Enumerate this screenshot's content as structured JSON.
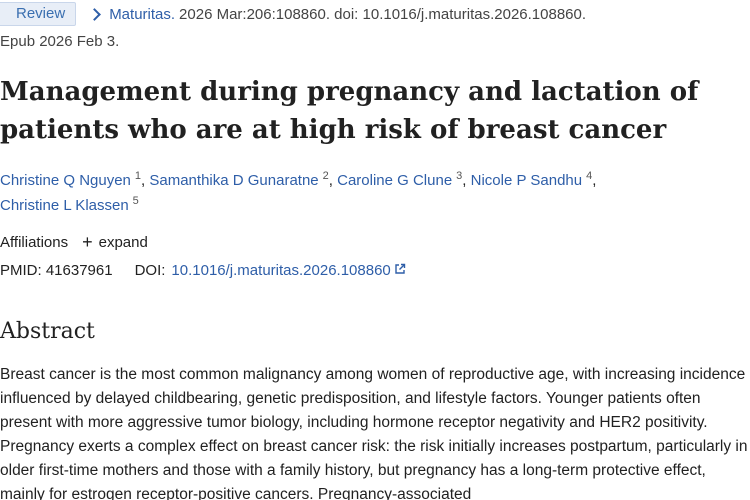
{
  "article": {
    "type_badge": "Review",
    "journal": "Maturitas.",
    "citation": "2026 Mar:206:108860. doi: 10.1016/j.maturitas.2026.108860.",
    "epub": "Epub 2026 Feb 3.",
    "title": "Management during pregnancy and lactation of patients who are at high risk of breast cancer",
    "authors": [
      {
        "name": "Christine Q Nguyen",
        "aff": "1"
      },
      {
        "name": "Samanthika D Gunaratne",
        "aff": "2"
      },
      {
        "name": "Caroline G Clune",
        "aff": "3"
      },
      {
        "name": "Nicole P Sandhu",
        "aff": "4"
      },
      {
        "name": "Christine L Klassen",
        "aff": "5"
      }
    ],
    "affiliations_label": "Affiliations",
    "expand_label": "expand",
    "pmid": "PMID: 41637961",
    "doi_label": "DOI:",
    "doi": "10.1016/j.maturitas.2026.108860",
    "abstract_heading": "Abstract",
    "abstract_text": "Breast cancer is the most common malignancy among women of reproductive age, with increasing incidence influenced by delayed childbearing, genetic predisposition, and lifestyle factors. Younger patients often present with more aggressive tumor biology, including hormone receptor negativity and HER2 positivity. Pregnancy exerts a complex effect on breast cancer risk: the risk initially increases postpartum, particularly in older first-time mothers and those with a family history, but pregnancy has a long-term protective effect, mainly for estrogen receptor-positive cancers. Pregnancy-associated"
  },
  "icons": {
    "breadcrumb": "chevron-right-icon",
    "expand": "plus-icon",
    "external": "external-link-icon"
  },
  "colors": {
    "link": "#2e5ea8",
    "badge_bg": "#e8eef7",
    "text": "#212121"
  }
}
